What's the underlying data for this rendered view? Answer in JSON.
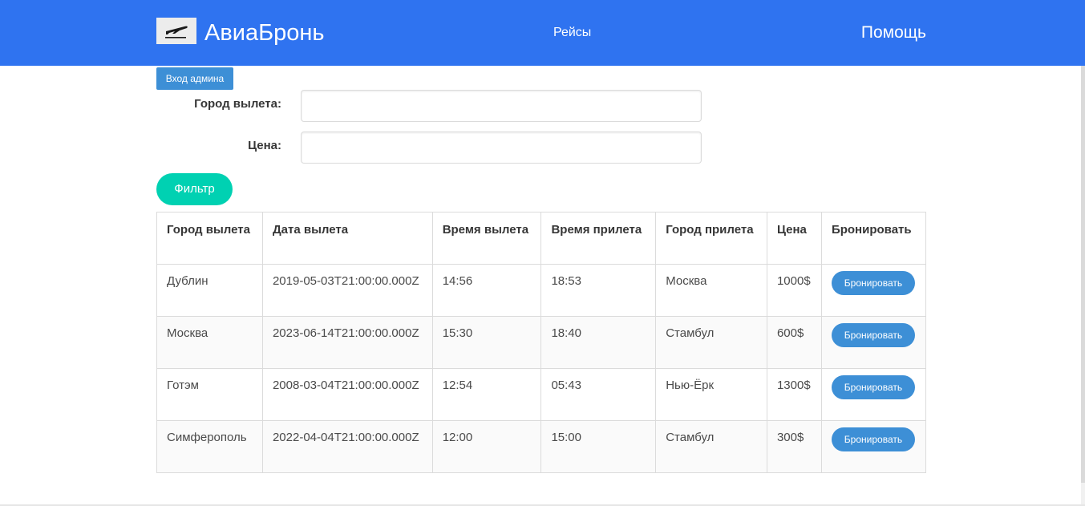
{
  "header": {
    "brand": "АвиаБронь",
    "nav_flights": "Рейсы",
    "nav_help": "Помощь",
    "logo_icon": "airplane-icon"
  },
  "admin_login_label": "Вход админа",
  "filters": {
    "city_label": "Город вылета:",
    "city_value": "",
    "price_label": "Цена:",
    "price_value": "",
    "filter_button": "Фильтр"
  },
  "table": {
    "columns": [
      "Город вылета",
      "Дата вылета",
      "Время вылета",
      "Время прилета",
      "Город прилета",
      "Цена",
      "Бронировать"
    ],
    "rows": [
      {
        "from": "Дублин",
        "date": "2019-05-03T21:00:00.000Z",
        "dep": "14:56",
        "arr": "18:53",
        "to": "Москва",
        "price": "1000$",
        "book": "Бронировать"
      },
      {
        "from": "Москва",
        "date": "2023-06-14T21:00:00.000Z",
        "dep": "15:30",
        "arr": "18:40",
        "to": "Стамбул",
        "price": "600$",
        "book": "Бронировать"
      },
      {
        "from": "Готэм",
        "date": "2008-03-04T21:00:00.000Z",
        "dep": "12:54",
        "arr": "05:43",
        "to": "Нью-Ёрк",
        "price": "1300$",
        "book": "Бронировать"
      },
      {
        "from": "Симферополь",
        "date": "2022-04-04T21:00:00.000Z",
        "dep": "12:00",
        "arr": "15:00",
        "to": "Стамбул",
        "price": "300$",
        "book": "Бронировать"
      }
    ]
  },
  "colors": {
    "navbar": "#2f73f0",
    "primary_button": "#3d8fd6",
    "filter_button": "#00d1b2"
  }
}
